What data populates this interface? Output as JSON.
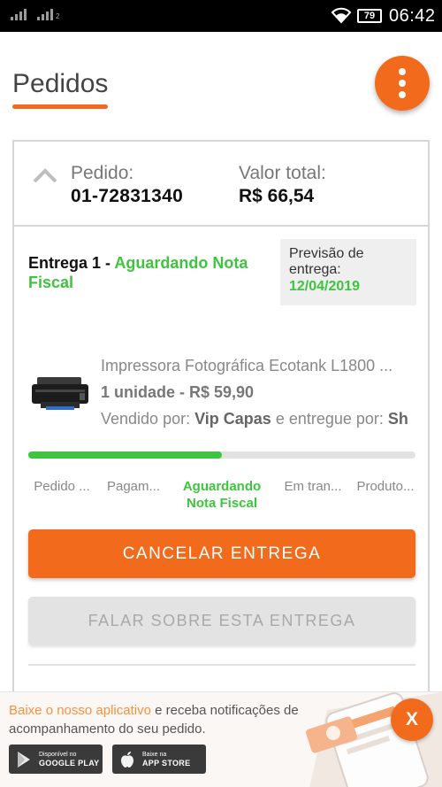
{
  "status_bar": {
    "signal1_sub": "",
    "signal2_sub": "2",
    "battery": "79",
    "time": "06:42"
  },
  "header": {
    "title": "Pedidos",
    "menu_icon": "more-vertical-icon"
  },
  "order": {
    "order_label": "Pedido:",
    "order_number": "01-72831340",
    "total_label": "Valor total:",
    "total_value": "R$ 66,54",
    "delivery": {
      "prefix": "Entrega 1 - ",
      "status": "Aguardando Nota Fiscal",
      "forecast_label": "Previsão de entrega:",
      "forecast_date": "12/04/2019"
    },
    "product": {
      "name": "Impressora Fotográfica Ecotank L1800 ...",
      "qty": "1 unidade - R$ 59,90",
      "sold_by_label": "Vendido por: ",
      "seller": "Vip Capas",
      "delivered_by_label": " e entregue por: ",
      "carrier": "Sh"
    },
    "progress": 0.5,
    "steps": [
      {
        "label": "Pedido ...",
        "active": false
      },
      {
        "label": "Pagam...",
        "active": false
      },
      {
        "label": "Aguardando Nota Fiscal",
        "active": true
      },
      {
        "label": "Em tran...",
        "active": false
      },
      {
        "label": "Produto...",
        "active": false
      }
    ],
    "cancel_label": "CANCELAR ENTREGA",
    "talk_label": "FALAR SOBRE ESTA ENTREGA"
  },
  "banner": {
    "highlight": "Baixe o nosso aplicativo",
    "text": " e receba notificações de acompanhamento do seu pedido.",
    "google_play_small": "Disponível no",
    "google_play": "GOOGLE PLAY",
    "app_store_small": "Baixe na",
    "app_store": "APP STORE",
    "close_label": "X"
  },
  "colors": {
    "accent": "#f26b1d",
    "success": "#3ec43e"
  }
}
